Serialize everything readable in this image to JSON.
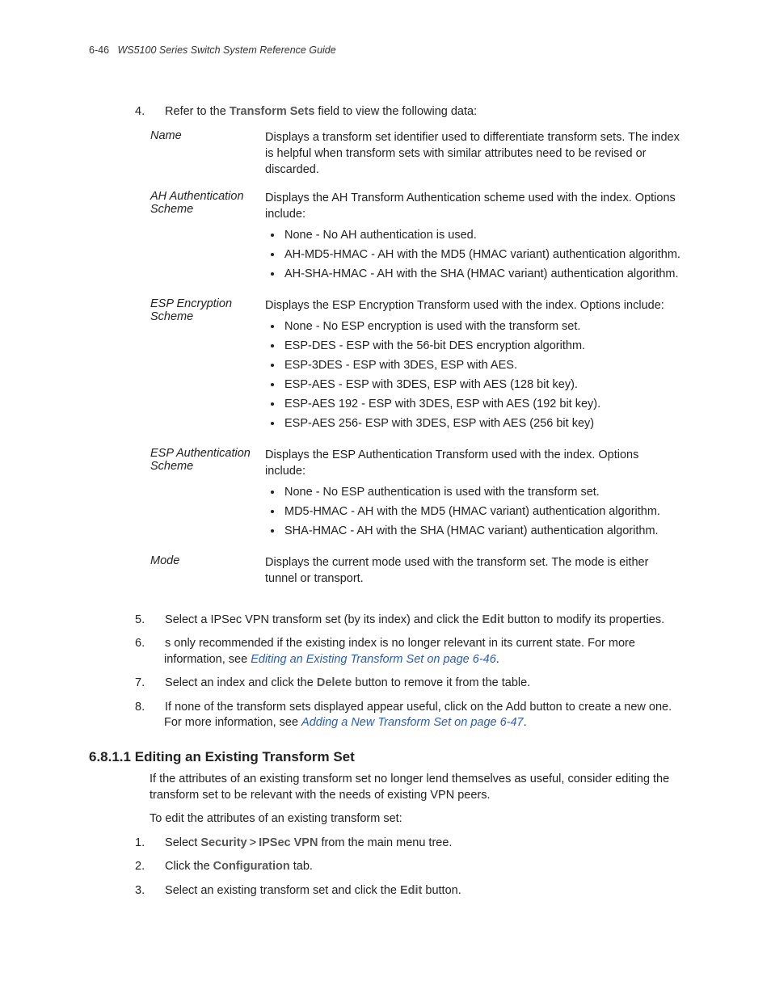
{
  "header": {
    "page_number": "6-46",
    "guide_title": "WS5100 Series Switch System Reference Guide"
  },
  "step4": {
    "num": "4.",
    "pre": "Refer to the ",
    "bold": "Transform Sets",
    "post": " field to view the following data:"
  },
  "defs": {
    "name_term": "Name",
    "name_def": "Displays a transform set identifier used to differentiate transform sets. The index is helpful when transform sets with similar attributes need to be revised or discarded.",
    "ah_term": "AH Authentication Scheme",
    "ah_intro": "Displays the AH Transform Authentication scheme used with the index. Options include:",
    "ah_b1": "None - No AH authentication is used.",
    "ah_b2": "AH-MD5-HMAC - AH with the MD5 (HMAC variant) authentication algorithm.",
    "ah_b3": "AH-SHA-HMAC - AH with the SHA (HMAC variant) authentication algorithm.",
    "espenc_term": "ESP Encryption Scheme",
    "espenc_intro": "Displays the ESP Encryption Transform used with the index. Options include:",
    "espenc_b1": "None - No ESP encryption is used with the transform set.",
    "espenc_b2": "ESP-DES - ESP with the 56-bit DES encryption algorithm.",
    "espenc_b3": "ESP-3DES - ESP with 3DES, ESP with AES.",
    "espenc_b4": "ESP-AES - ESP with 3DES, ESP with AES (128 bit key).",
    "espenc_b5": "ESP-AES 192 - ESP with 3DES, ESP with AES (192 bit key).",
    "espenc_b6": "ESP-AES 256- ESP with 3DES, ESP with AES (256 bit key)",
    "espauth_term": "ESP Authentication Scheme",
    "espauth_intro": "Displays the ESP Authentication Transform used with the index. Options include:",
    "espauth_b1": "None - No ESP authentication is used with the transform set.",
    "espauth_b2": "MD5-HMAC - AH with the MD5 (HMAC variant) authentication algorithm.",
    "espauth_b3": "SHA-HMAC - AH with the SHA (HMAC variant) authentication algorithm.",
    "mode_term": "Mode",
    "mode_def": "Displays the current mode used with the transform set. The mode is either tunnel or transport."
  },
  "step5": {
    "num": "5.",
    "pre": "Select a IPSec VPN transform set (by its index) and click the ",
    "bold": "Edit",
    "post": " button to modify its properties."
  },
  "step6": {
    "num": "6.",
    "pre": "s only recommended if the existing index is no longer relevant in its current state. For more information, see ",
    "link": "Editing an Existing Transform Set on page 6-46",
    "post": "."
  },
  "step7": {
    "num": "7.",
    "pre": "Select an index and click the ",
    "bold": "Delete",
    "post": " button to remove it from the table."
  },
  "step8": {
    "num": "8.",
    "pre": "If none of the transform sets displayed appear useful, click on the Add button to create a new one. For more information, see ",
    "link": "Adding a New Transform Set on page 6-47",
    "post": "."
  },
  "section": {
    "num": "6.8.1.1",
    "title": "Editing an Existing Transform Set",
    "p1": "If the attributes of an existing transform set no longer lend themselves as useful, consider editing the transform set to be relevant with the needs of existing VPN peers.",
    "p2": "To edit the attributes of an existing transform set:"
  },
  "edit1": {
    "num": "1.",
    "pre": "Select ",
    "b1": "Security",
    "gt": ">",
    "b2": "IPSec VPN",
    "post": " from the main menu tree."
  },
  "edit2": {
    "num": "2.",
    "pre": "Click the ",
    "bold": "Configuration",
    "post": " tab."
  },
  "edit3": {
    "num": "3.",
    "pre": "Select an existing transform set and click the ",
    "bold": "Edit",
    "post": " button."
  }
}
